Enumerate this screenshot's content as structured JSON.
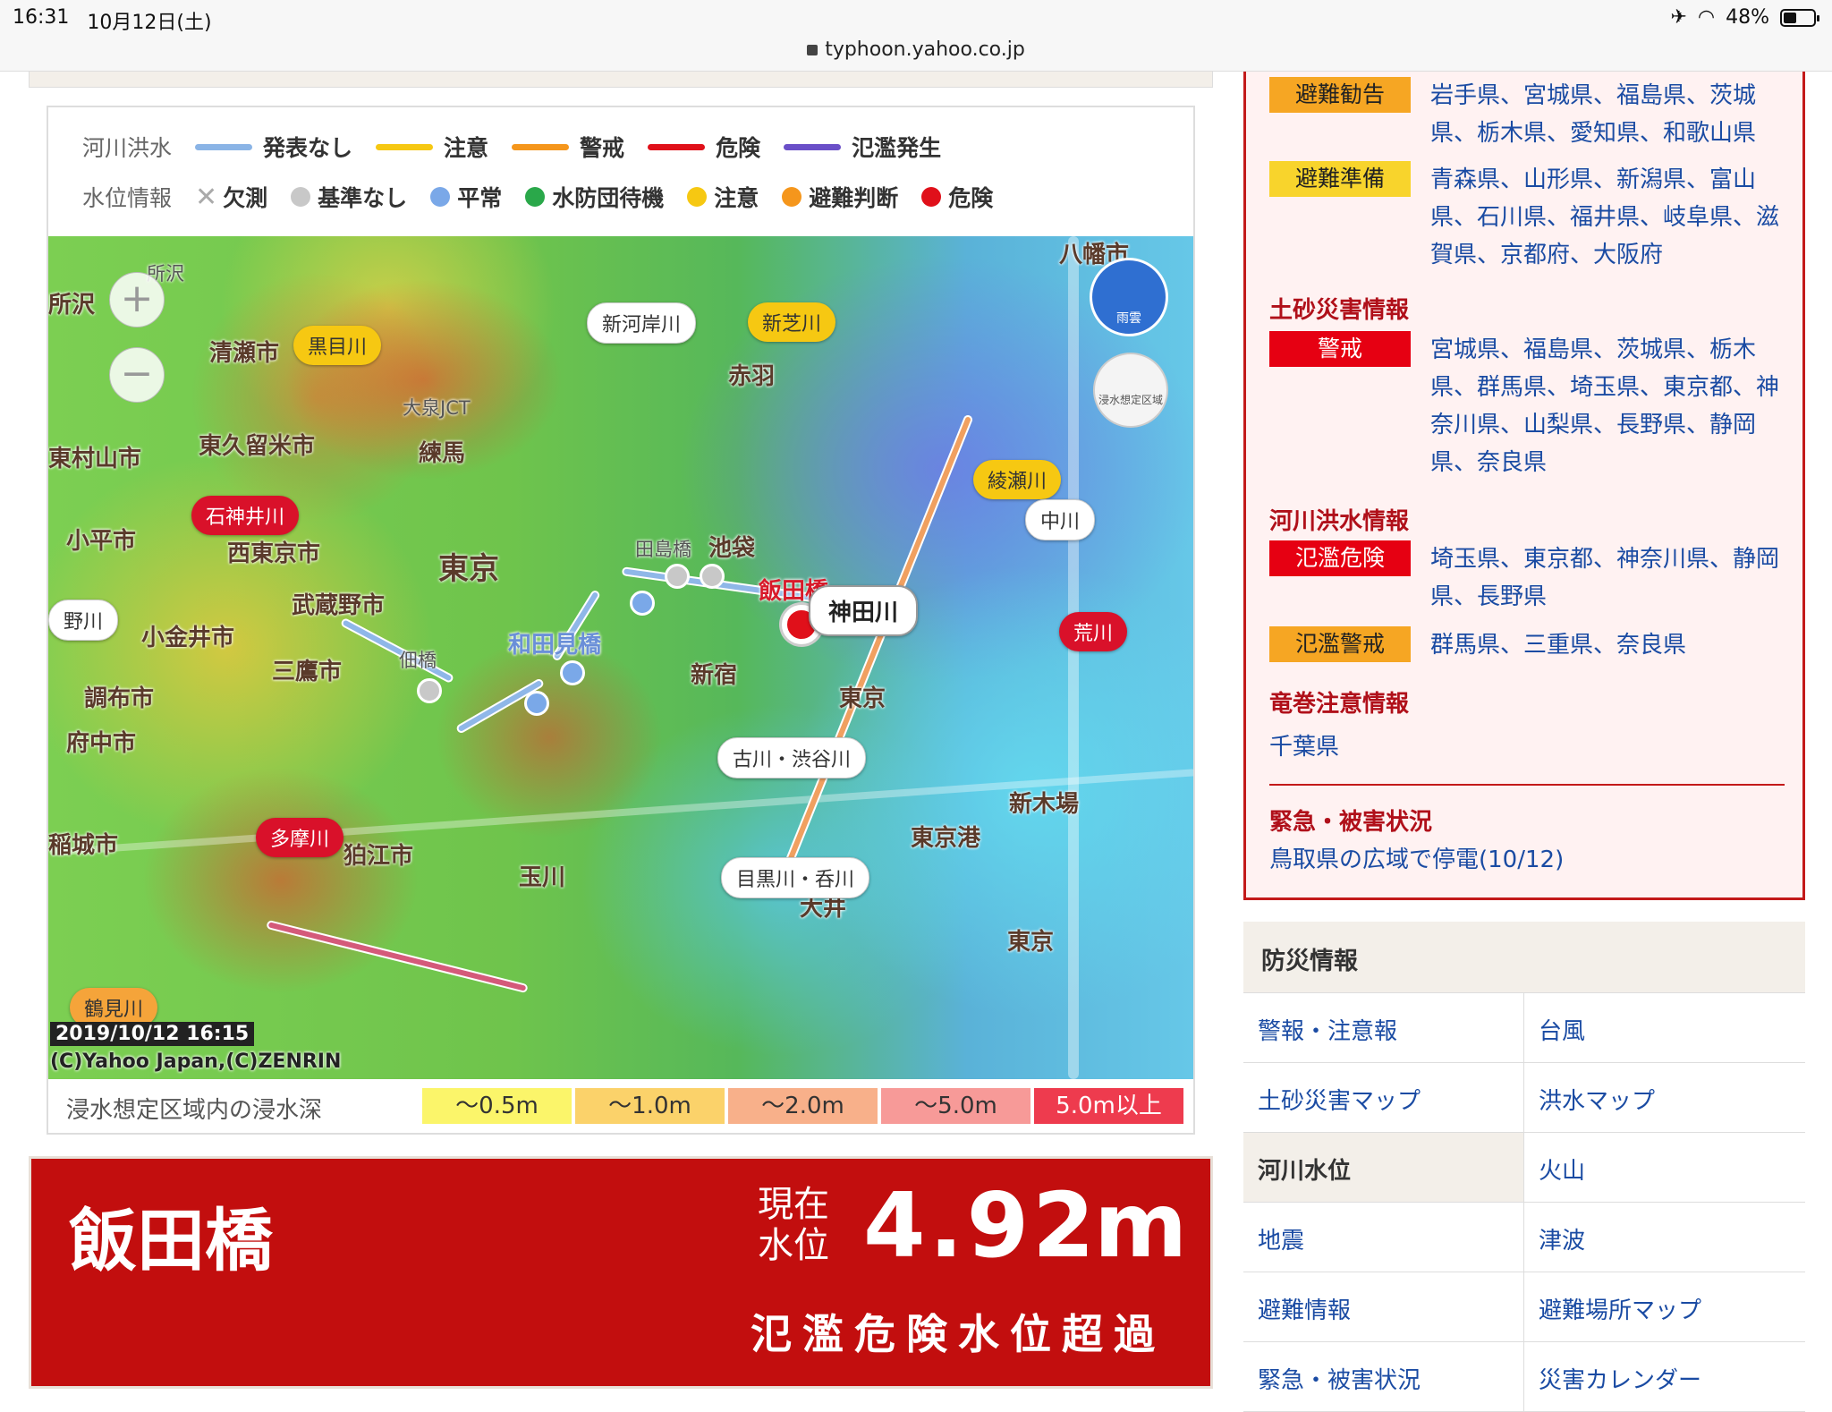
{
  "status": {
    "time": "16:31",
    "date": "10月12日(土)",
    "battery": "48%",
    "url": "typhoon.yahoo.co.jp"
  },
  "legend": {
    "river_head": "河川洪水",
    "river_items": [
      {
        "label": "発表なし",
        "color": "#8ab4e6"
      },
      {
        "label": "注意",
        "color": "#f6c812"
      },
      {
        "label": "警戒",
        "color": "#f5961c"
      },
      {
        "label": "危険",
        "color": "#e0101a"
      },
      {
        "label": "氾濫発生",
        "color": "#6a4fc8"
      }
    ],
    "level_head": "水位情報",
    "level_items": [
      {
        "label": "欠測",
        "color": "none"
      },
      {
        "label": "基準なし",
        "color": "#c8c8c8"
      },
      {
        "label": "平常",
        "color": "#7aa8e8"
      },
      {
        "label": "水防団待機",
        "color": "#2aa84a"
      },
      {
        "label": "注意",
        "color": "#f6c812"
      },
      {
        "label": "避難判断",
        "color": "#f5961c"
      },
      {
        "label": "危険",
        "color": "#e0101a"
      }
    ]
  },
  "map": {
    "places": {
      "tokorozawa": "所沢",
      "kiyose": "清瀬市",
      "higashikurume": "東久留米市",
      "nerima": "練馬",
      "kodaira": "小平市",
      "nishitokyo": "西東京市",
      "musashino": "武蔵野市",
      "koganei": "小金井市",
      "mitaka": "三鷹市",
      "chofu": "調布市",
      "fuchu": "府中市",
      "komae": "狛江市",
      "tokyo": "東京",
      "shinjuku": "新宿",
      "ikebukuro": "池袋",
      "akabane": "赤羽",
      "tokyoport": "東京港",
      "shinkiba": "新木場",
      "oi": "大井",
      "tamagawa": "玉川",
      "iidabashi": "飯田橋",
      "wadamibashi": "和田見橋",
      "tajimabashi": "田島橋",
      "tsukudabashi": "佃橋",
      "higashimurayama": "東村山市",
      "inagi": "稲城市",
      "ojunction": "大泉JCT",
      "hachiman": "八幡市"
    },
    "rivers": {
      "kurome": "黒目川",
      "shinkashi": "新河岸川",
      "shinshiba": "新芝川",
      "shakujii": "石神井川",
      "kanda": "神田川",
      "ayase": "綾瀬川",
      "naka": "中川",
      "ara": "荒川",
      "no": "野川",
      "tama": "多摩川",
      "furu": "古川・渋谷川",
      "meguro": "目黒川・呑川",
      "tsurumi": "鶴見川"
    },
    "controls": {
      "zoom_in": "+",
      "zoom_out": "−",
      "rain": "雨雲",
      "flood": "浸水想定区域"
    },
    "timestamp": "2019/10/12 16:15",
    "copyright": "(C)Yahoo Japan,(C)ZENRIN"
  },
  "depth": {
    "label": "浸水想定区域内の浸水深",
    "cells": [
      {
        "label": "～0.5m",
        "color": "#fbf56a"
      },
      {
        "label": "～1.0m",
        "color": "#fbd26a"
      },
      {
        "label": "～2.0m",
        "color": "#f8b08a"
      },
      {
        "label": "～5.0m",
        "color": "#f79a98"
      },
      {
        "label": "5.0m以上",
        "color": "#ee3b4e"
      }
    ]
  },
  "banner": {
    "station": "飯田橋",
    "cur_label_1": "現在",
    "cur_label_2": "水位",
    "value": "4.92",
    "unit": "m",
    "status": "氾濫危険水位超過"
  },
  "alerts": {
    "kankoku_badge": "避難勧告",
    "kankoku_prefs": "岩手県、宮城県、福島県、茨城県、栃木県、愛知県、和歌山県",
    "junbi_badge": "避難準備",
    "junbi_prefs": "青森県、山形県、新潟県、富山県、石川県、福井県、岐阜県、滋賀県、京都府、大阪府",
    "dosha_head": "土砂災害情報",
    "dosha_badge": "警戒",
    "dosha_prefs": "宮城県、福島県、茨城県、栃木県、群馬県、埼玉県、東京都、神奈川県、山梨県、長野県、静岡県、奈良県",
    "kasen_head": "河川洪水情報",
    "kiken_badge": "氾濫危険",
    "kiken_prefs": "埼玉県、東京都、神奈川県、静岡県、長野県",
    "keikai_badge": "氾濫警戒",
    "keikai_prefs": "群馬県、三重県、奈良県",
    "tatsumaki_head": "竜巻注意情報",
    "tatsumaki_prefs": "千葉県",
    "kinkyu_head": "緊急・被害状況",
    "kinkyu_link": "鳥取県の広域で停電(10/12)"
  },
  "bousai": {
    "title": "防災情報",
    "items": [
      "警報・注意報",
      "台風",
      "土砂災害マップ",
      "洪水マップ",
      "河川水位",
      "火山",
      "地震",
      "津波",
      "避難情報",
      "避難場所マップ",
      "緊急・被害状況",
      "災害カレンダー"
    ]
  }
}
